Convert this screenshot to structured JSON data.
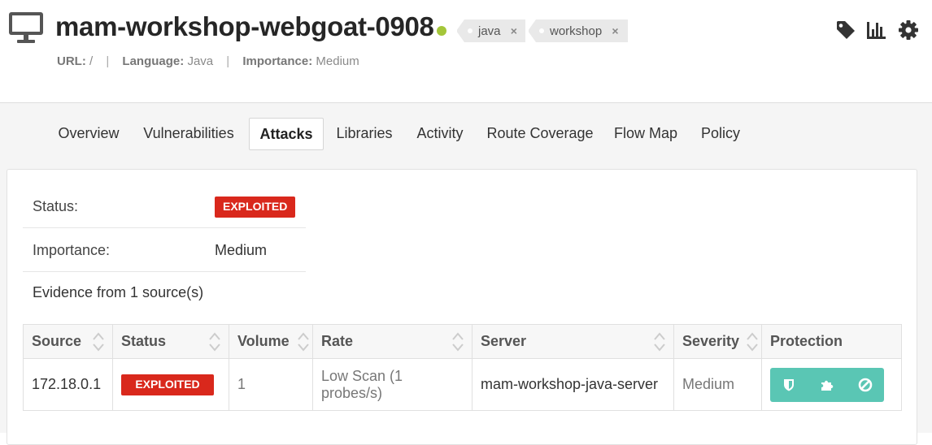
{
  "app": {
    "title": "mam-workshop-webgoat-0908",
    "status_color": "#a4c639",
    "tags": [
      {
        "label": "java",
        "remove": "×"
      },
      {
        "label": "workshop",
        "remove": "×"
      }
    ],
    "meta": {
      "url_label": "URL:",
      "url_value": "/",
      "language_label": "Language:",
      "language_value": "Java",
      "importance_label": "Importance:",
      "importance_value": "Medium",
      "separator": "|"
    },
    "icons": [
      "monitor-icon",
      "tag-icon",
      "bar-chart-icon",
      "gear-icon"
    ]
  },
  "tabs": [
    {
      "label": "Overview"
    },
    {
      "label": "Vulnerabilities"
    },
    {
      "label": "Attacks",
      "active": true
    },
    {
      "label": "Libraries"
    },
    {
      "label": "Activity"
    },
    {
      "label": "Route Coverage"
    },
    {
      "label": "Flow Map"
    },
    {
      "label": "Policy"
    }
  ],
  "details": {
    "status_label": "Status:",
    "status_value": "EXPLOITED",
    "importance_label": "Importance:",
    "importance_value": "Medium",
    "evidence_text": "Evidence from 1 source(s)"
  },
  "table": {
    "columns": [
      "Source",
      "Status",
      "Volume",
      "Rate",
      "Server",
      "Severity",
      "Protection"
    ],
    "rows": [
      {
        "source": "172.18.0.1",
        "status": "EXPLOITED",
        "volume": "1",
        "rate": "Low Scan (1 probes/s)",
        "server": "mam-workshop-java-server",
        "severity": "Medium",
        "protection_icons": [
          "shield-icon",
          "puzzle-icon",
          "block-icon"
        ]
      }
    ]
  },
  "colors": {
    "exploited_badge": "#d9281c",
    "protection_button": "#5ac6b4",
    "accent_dark": "#262626"
  }
}
